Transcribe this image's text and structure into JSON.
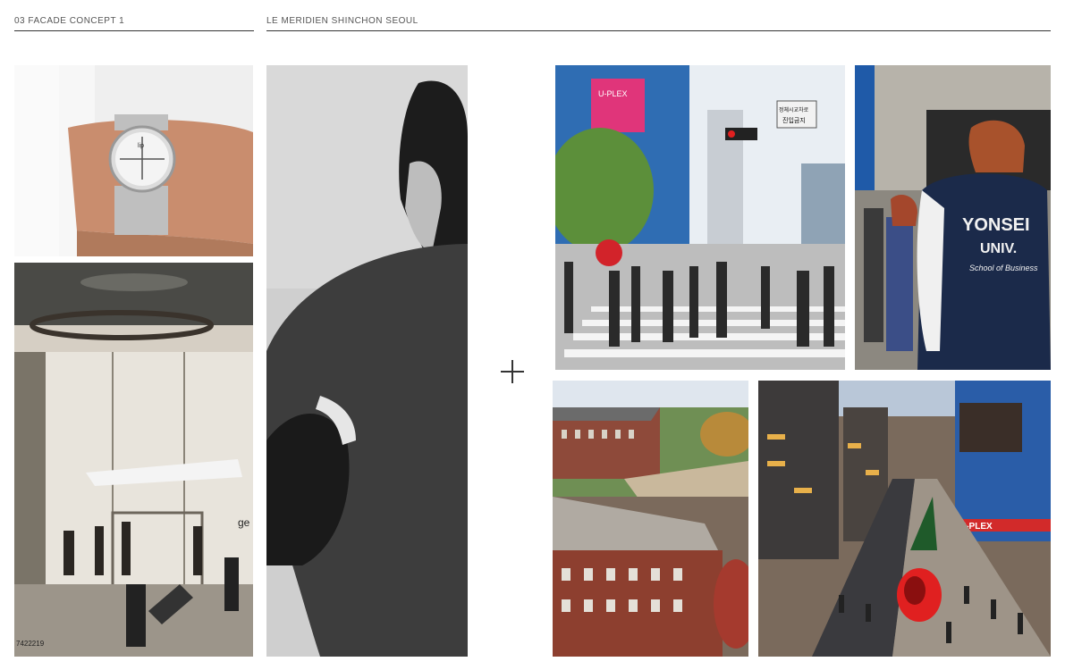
{
  "header": {
    "section_label": "03 FACADE CONCEPT 1",
    "project_label": "LE MERIDIEN SHINCHON SEOUL"
  },
  "photos": {
    "watch": {
      "brand": "lip"
    },
    "airport": {
      "caption_fragment": "7422219",
      "sign_fragment": "ge"
    },
    "fashion": {},
    "crossing": {
      "sign_line1": "정체시교차로",
      "sign_line2": "진입금지",
      "billboard": "U-PLEX"
    },
    "jacket": {
      "line1": "YONSEI",
      "line2": "UNIV.",
      "line3": "School of Business"
    },
    "campus": {},
    "street": {
      "sign": "U-PLEX"
    }
  },
  "divider": {
    "symbol": "plus-icon"
  }
}
